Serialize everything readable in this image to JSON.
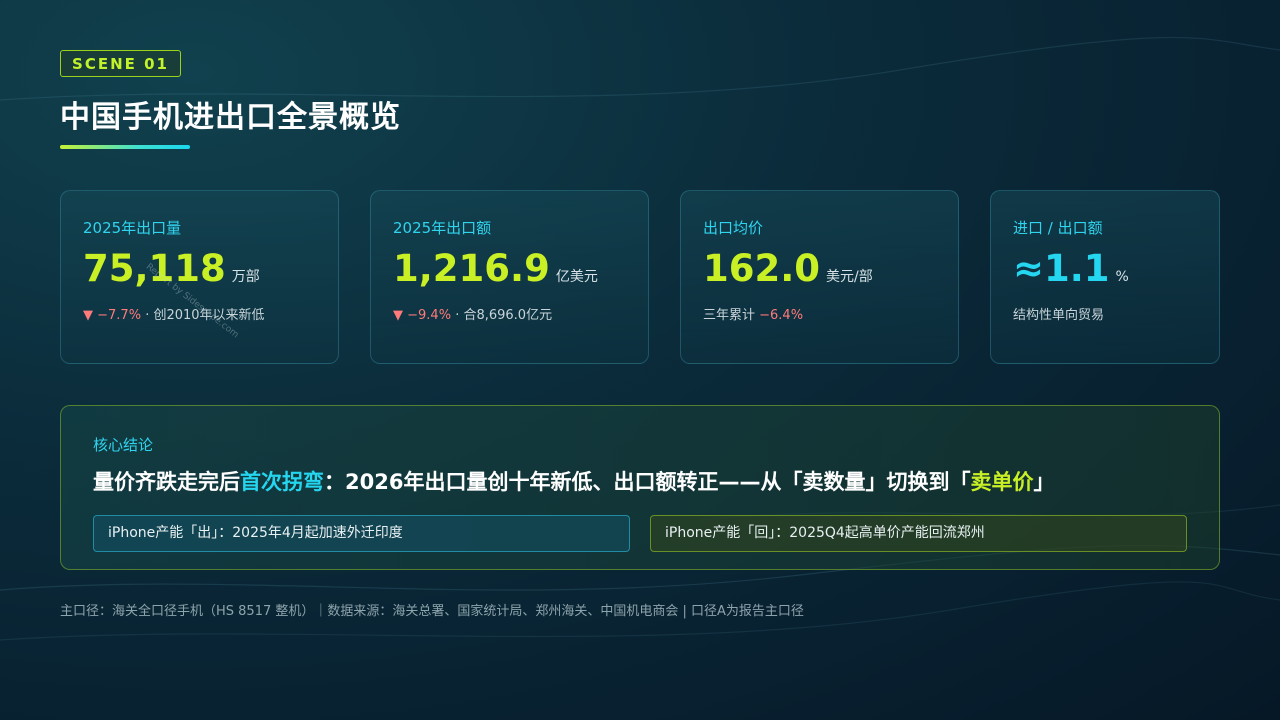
{
  "header": {
    "scene_tag": "SCENE 01",
    "title": "中国手机进出口全景概览"
  },
  "cards": [
    {
      "label": "2025年出口量",
      "value": "75,118",
      "unit": "万部",
      "change": "▼ −7.7%",
      "note": " · 创2010年以来新低"
    },
    {
      "label": "2025年出口额",
      "value": "1,216.9",
      "unit": "亿美元",
      "change": "▼ −9.4%",
      "note": " · 合8,696.0亿元"
    },
    {
      "label": "出口均价",
      "value": "162.0",
      "unit": "美元/部",
      "note_prefix": "三年累计 ",
      "change": "−6.4%"
    },
    {
      "label": "进口 / 出口额",
      "value": "≈1.1",
      "unit": "%",
      "note": "结构性单向贸易"
    }
  ],
  "conclusion": {
    "label": "核心结论",
    "headline_part1": "量价齐跌走完后",
    "headline_highlight1": "首次拐弯",
    "headline_part2": "：2026年出口量创十年新低、出口额转正——从「卖数量」切换到「",
    "headline_highlight2": "卖单价",
    "headline_part3": "」",
    "box_left": "iPhone产能「出」：2025年4月起加速外迁印度",
    "box_right": "iPhone产能「回」：2025Q4起高单价产能回流郑州"
  },
  "footnote": "主口径：海关全口径手机（HS 8517 整机）｜数据来源：海关总署、国家统计局、郑州海关、中国机电商会 | 口径A为报告主口径",
  "watermark": "Report by Sidescape.com",
  "colors": {
    "accent_lime": "#c8f025",
    "accent_cyan": "#25d6f0",
    "negative": "#ff7a7a",
    "background": "#0b2c3b"
  }
}
